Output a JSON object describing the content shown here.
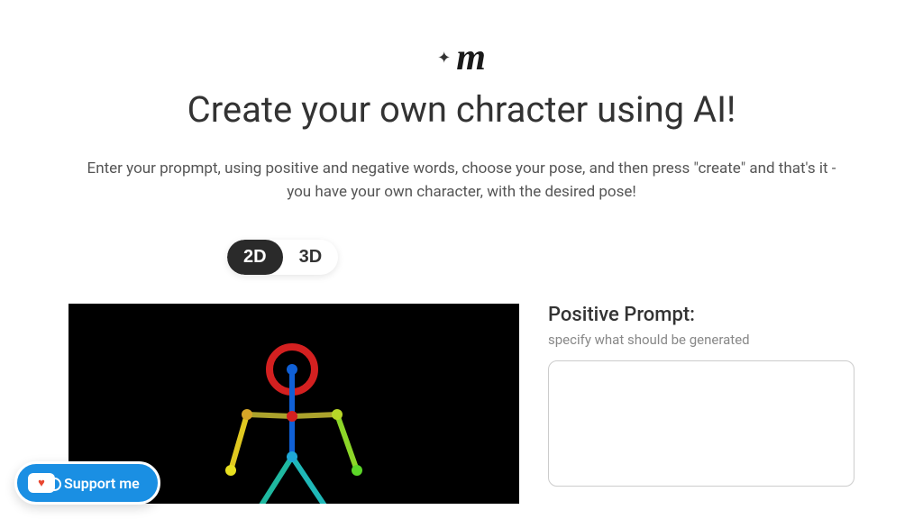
{
  "headline": "Create your own chracter using AI!",
  "description": "Enter your propmpt, using positive and negative words, choose your pose, and then press \"create\" and that's it - you have your own character, with the desired pose!",
  "toggle": {
    "option1": "2D",
    "option2": "3D"
  },
  "form": {
    "positive_label": "Positive Prompt:",
    "positive_hint": "specify what should be generated"
  },
  "support_label": "Support me"
}
